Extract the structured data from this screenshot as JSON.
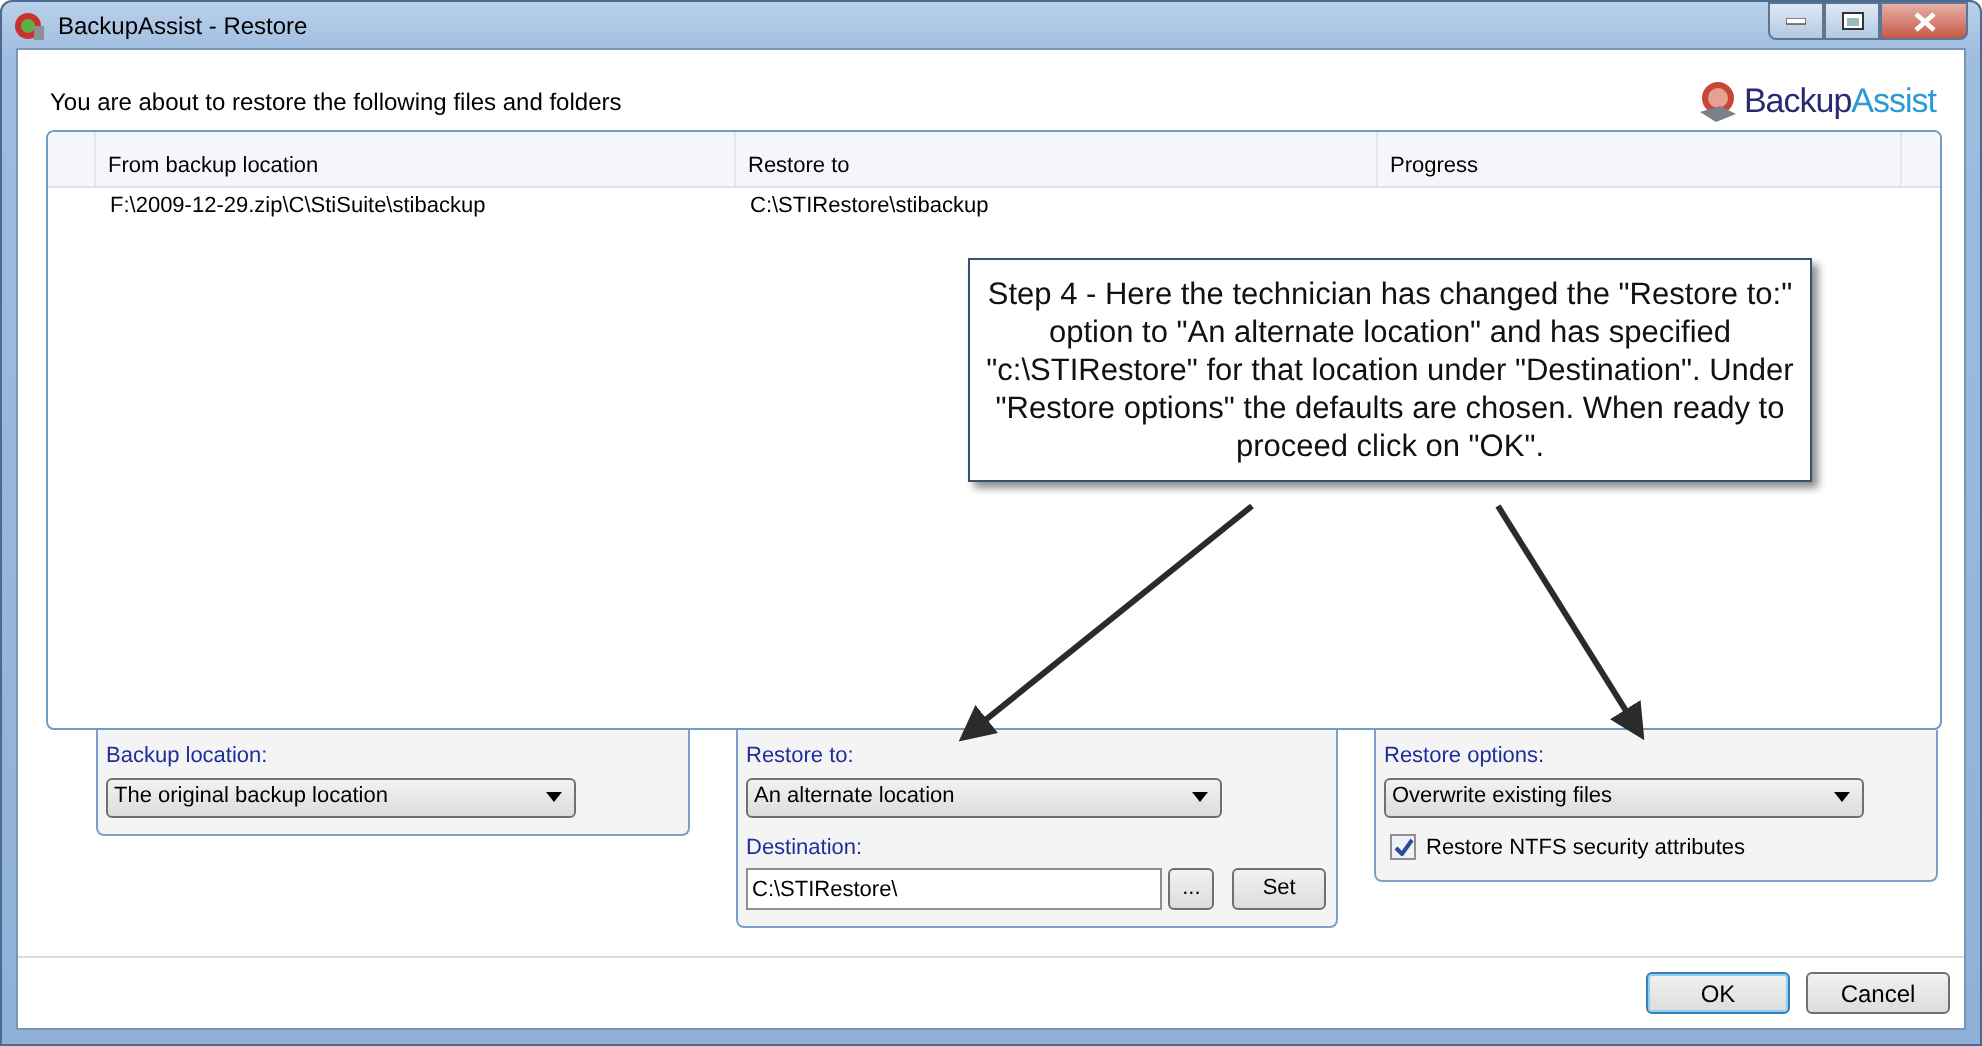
{
  "window": {
    "title": "BackupAssist - Restore"
  },
  "header": {
    "text": "You are about to restore the following files and folders",
    "logo_part_1": "Backup",
    "logo_part_2": "Assist"
  },
  "table": {
    "columns": [
      "From backup location",
      "Restore to",
      "Progress"
    ],
    "rows": [
      {
        "from": "F:\\2009-12-29.zip\\C\\StiSuite\\stibackup",
        "restore_to": "C:\\STIRestore\\stibackup"
      }
    ]
  },
  "backup_location": {
    "label": "Backup location:",
    "value": "The original backup location"
  },
  "restore_to": {
    "label": "Restore to:",
    "value": "An alternate location",
    "destination_label": "Destination:",
    "destination_value": "C:\\STIRestore\\",
    "browse_button": "...",
    "set_button": "Set"
  },
  "restore_options": {
    "label": "Restore options:",
    "value": "Overwrite existing files",
    "checkbox": {
      "label": "Restore NTFS security attributes",
      "checked": true
    }
  },
  "buttons": [
    {
      "label": "OK",
      "default": true
    },
    {
      "label": "Cancel",
      "default": false
    }
  ],
  "callout": {
    "text": "Step 4 - Here the technician has changed the \"Restore to:\" option to \"An alternate location\" and has specified \"c:\\STIRestore\" for that location under \"Destination\".  Under \"Restore options\" the defaults are chosen.  When ready to proceed click on \"OK\"."
  }
}
